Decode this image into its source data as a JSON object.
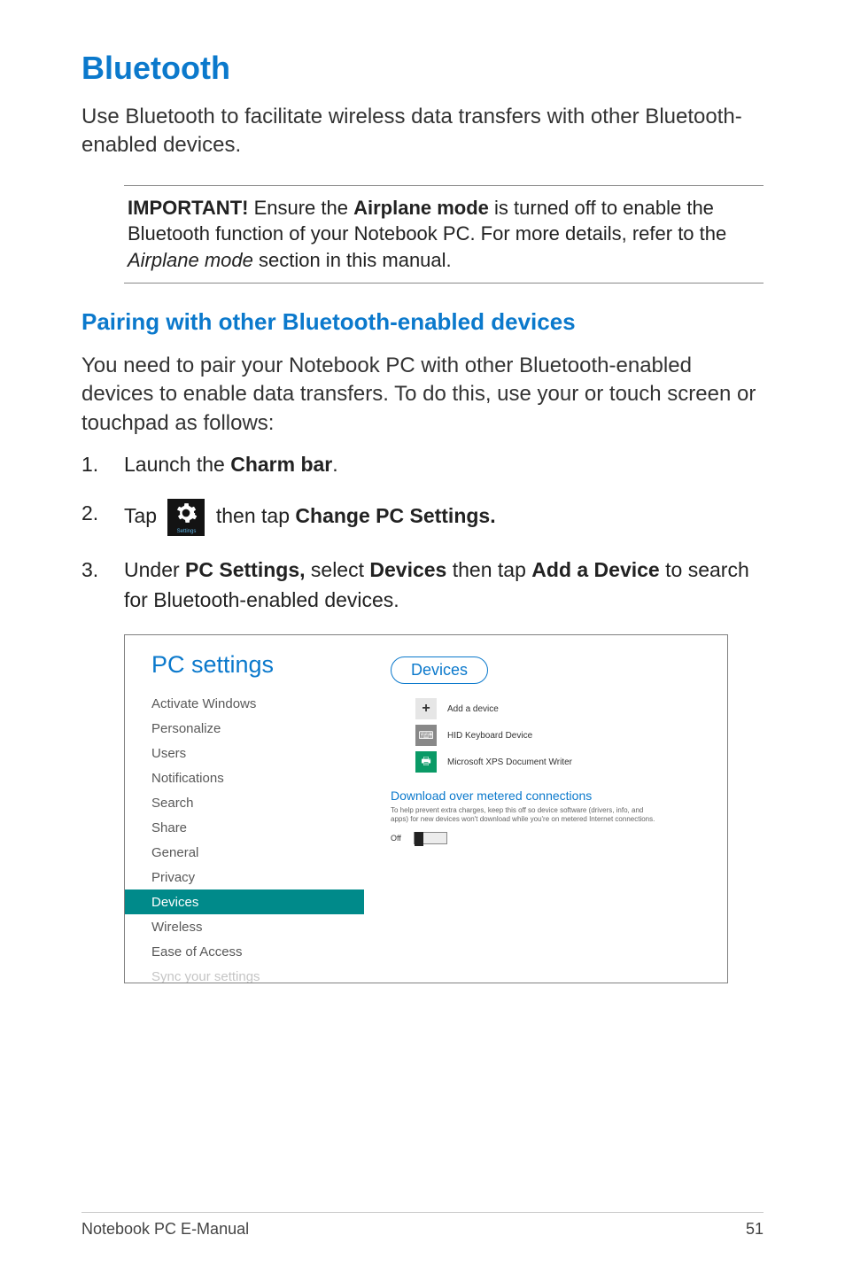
{
  "heading": "Bluetooth",
  "intro": "Use Bluetooth to facilitate wireless data transfers with other Bluetooth-enabled devices.",
  "note": {
    "important_label": "IMPORTANT!",
    "part1": " Ensure the ",
    "airplane_mode": "Airplane mode",
    "part2": " is turned off to enable the Bluetooth function of your Notebook PC. For more details, refer to the ",
    "airplane_section": "Airplane mode",
    "part3": " section in this manual."
  },
  "subheading": "Pairing with other Bluetooth-enabled devices",
  "subintro": "You need to pair your Notebook PC with other Bluetooth-enabled devices to enable data transfers. To do this, use your or touch screen or touchpad as follows:",
  "steps": {
    "s1_a": "Launch the ",
    "s1_b": "Charm bar",
    "s1_c": ".",
    "s2_a": "Tap ",
    "s2_icon_label": "Settings",
    "s2_b": " then tap ",
    "s2_c": "Change PC Settings.",
    "s3_a": "Under ",
    "s3_b": "PC Settings,",
    "s3_c": " select ",
    "s3_d": "Devices",
    "s3_e": " then tap ",
    "s3_f": "Add a Device",
    "s3_g": " to search for Bluetooth-enabled devices."
  },
  "screenshot": {
    "title": "PC settings",
    "items": [
      "Activate Windows",
      "Personalize",
      "Users",
      "Notifications",
      "Search",
      "Share",
      "General",
      "Privacy",
      "Devices",
      "Wireless",
      "Ease of Access",
      "Sync your settings"
    ],
    "selected_index": 8,
    "right": {
      "header": "Devices",
      "add_label": "Add a device",
      "dev1": "HID Keyboard Device",
      "dev2": "Microsoft XPS Document Writer",
      "subhead": "Download over metered connections",
      "note": "To help prevent extra charges, keep this off so device software (drivers, info, and apps) for new devices won't download while you're on metered Internet connections.",
      "toggle": "Off"
    }
  },
  "footer": {
    "left": "Notebook PC E-Manual",
    "right": "51"
  }
}
